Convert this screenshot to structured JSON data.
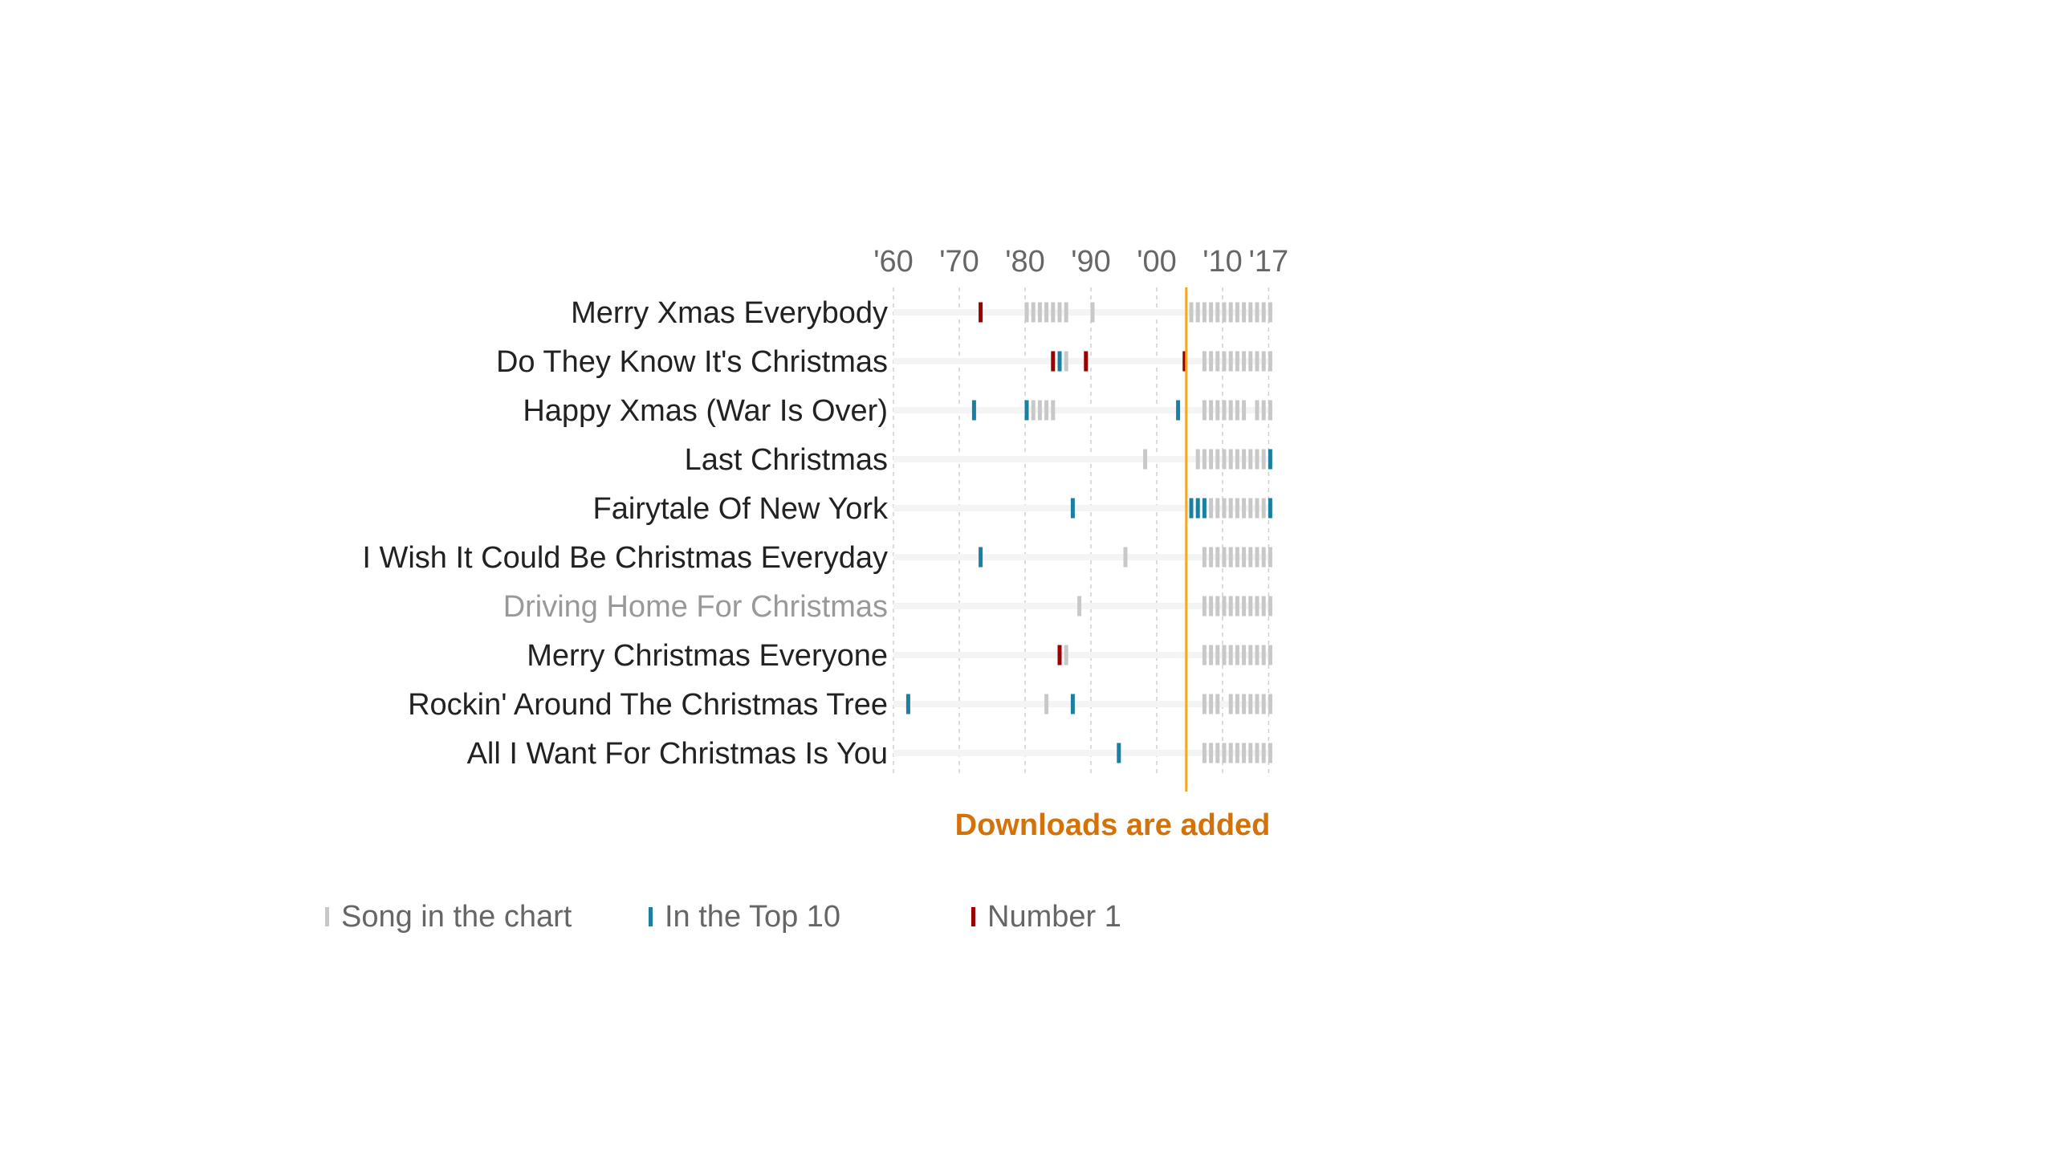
{
  "chart_data": {
    "type": "table",
    "subtype": "timeline-strip",
    "title": "",
    "xlabel": "",
    "ylabel": "",
    "x_range": [
      1960,
      2017
    ],
    "x_ticks": [
      {
        "year": 1960,
        "label": "'60"
      },
      {
        "year": 1970,
        "label": "'70"
      },
      {
        "year": 1980,
        "label": "'80"
      },
      {
        "year": 1990,
        "label": "'90"
      },
      {
        "year": 2000,
        "label": "'00"
      },
      {
        "year": 2010,
        "label": "'10"
      },
      {
        "year": 2017,
        "label": "'17"
      }
    ],
    "grid": true,
    "status_legend": {
      "chart": {
        "label": "Song in the chart",
        "color": "#c8c8c8"
      },
      "top10": {
        "label": "In the Top 10",
        "color": "#1a7fa0"
      },
      "number1": {
        "label": "Number 1",
        "color": "#990000"
      }
    },
    "annotation": {
      "label": "Downloads are added",
      "year": 2004,
      "line_color": "#f5a623",
      "text_color": "#d4720a"
    },
    "songs": [
      {
        "title": "Merry Xmas Everybody",
        "muted": false,
        "entries": [
          {
            "year": 1973,
            "status": "number1"
          },
          {
            "year": 1980,
            "status": "chart"
          },
          {
            "year": 1981,
            "status": "chart"
          },
          {
            "year": 1982,
            "status": "chart"
          },
          {
            "year": 1983,
            "status": "chart"
          },
          {
            "year": 1984,
            "status": "chart"
          },
          {
            "year": 1985,
            "status": "chart"
          },
          {
            "year": 1986,
            "status": "chart"
          },
          {
            "year": 1990,
            "status": "chart"
          },
          {
            "year": 2005,
            "status": "chart"
          },
          {
            "year": 2006,
            "status": "chart"
          },
          {
            "year": 2007,
            "status": "chart"
          },
          {
            "year": 2008,
            "status": "chart"
          },
          {
            "year": 2009,
            "status": "chart"
          },
          {
            "year": 2010,
            "status": "chart"
          },
          {
            "year": 2011,
            "status": "chart"
          },
          {
            "year": 2012,
            "status": "chart"
          },
          {
            "year": 2013,
            "status": "chart"
          },
          {
            "year": 2014,
            "status": "chart"
          },
          {
            "year": 2015,
            "status": "chart"
          },
          {
            "year": 2016,
            "status": "chart"
          },
          {
            "year": 2017,
            "status": "chart"
          }
        ]
      },
      {
        "title": "Do They Know It's Christmas",
        "muted": false,
        "entries": [
          {
            "year": 1984,
            "status": "number1"
          },
          {
            "year": 1985,
            "status": "top10"
          },
          {
            "year": 1986,
            "status": "chart"
          },
          {
            "year": 1989,
            "status": "number1"
          },
          {
            "year": 2004,
            "status": "number1"
          },
          {
            "year": 2007,
            "status": "chart"
          },
          {
            "year": 2008,
            "status": "chart"
          },
          {
            "year": 2009,
            "status": "chart"
          },
          {
            "year": 2010,
            "status": "chart"
          },
          {
            "year": 2011,
            "status": "chart"
          },
          {
            "year": 2012,
            "status": "chart"
          },
          {
            "year": 2013,
            "status": "chart"
          },
          {
            "year": 2014,
            "status": "chart"
          },
          {
            "year": 2015,
            "status": "chart"
          },
          {
            "year": 2016,
            "status": "chart"
          },
          {
            "year": 2017,
            "status": "chart"
          }
        ]
      },
      {
        "title": "Happy Xmas (War Is Over)",
        "muted": false,
        "entries": [
          {
            "year": 1972,
            "status": "top10"
          },
          {
            "year": 1980,
            "status": "top10"
          },
          {
            "year": 1981,
            "status": "chart"
          },
          {
            "year": 1982,
            "status": "chart"
          },
          {
            "year": 1983,
            "status": "chart"
          },
          {
            "year": 1984,
            "status": "chart"
          },
          {
            "year": 2003,
            "status": "top10"
          },
          {
            "year": 2007,
            "status": "chart"
          },
          {
            "year": 2008,
            "status": "chart"
          },
          {
            "year": 2009,
            "status": "chart"
          },
          {
            "year": 2010,
            "status": "chart"
          },
          {
            "year": 2011,
            "status": "chart"
          },
          {
            "year": 2012,
            "status": "chart"
          },
          {
            "year": 2013,
            "status": "chart"
          },
          {
            "year": 2015,
            "status": "chart"
          },
          {
            "year": 2016,
            "status": "chart"
          },
          {
            "year": 2017,
            "status": "chart"
          }
        ]
      },
      {
        "title": "Last Christmas",
        "muted": false,
        "entries": [
          {
            "year": 1998,
            "status": "chart"
          },
          {
            "year": 2006,
            "status": "chart"
          },
          {
            "year": 2007,
            "status": "chart"
          },
          {
            "year": 2008,
            "status": "chart"
          },
          {
            "year": 2009,
            "status": "chart"
          },
          {
            "year": 2010,
            "status": "chart"
          },
          {
            "year": 2011,
            "status": "chart"
          },
          {
            "year": 2012,
            "status": "chart"
          },
          {
            "year": 2013,
            "status": "chart"
          },
          {
            "year": 2014,
            "status": "chart"
          },
          {
            "year": 2015,
            "status": "chart"
          },
          {
            "year": 2016,
            "status": "chart"
          },
          {
            "year": 2017,
            "status": "top10"
          }
        ]
      },
      {
        "title": "Fairytale Of New York",
        "muted": false,
        "entries": [
          {
            "year": 1987,
            "status": "top10"
          },
          {
            "year": 2005,
            "status": "top10"
          },
          {
            "year": 2006,
            "status": "top10"
          },
          {
            "year": 2007,
            "status": "top10"
          },
          {
            "year": 2008,
            "status": "chart"
          },
          {
            "year": 2009,
            "status": "chart"
          },
          {
            "year": 2010,
            "status": "chart"
          },
          {
            "year": 2011,
            "status": "chart"
          },
          {
            "year": 2012,
            "status": "chart"
          },
          {
            "year": 2013,
            "status": "chart"
          },
          {
            "year": 2014,
            "status": "chart"
          },
          {
            "year": 2015,
            "status": "chart"
          },
          {
            "year": 2016,
            "status": "chart"
          },
          {
            "year": 2017,
            "status": "top10"
          }
        ]
      },
      {
        "title": "I Wish It Could Be Christmas Everyday",
        "muted": false,
        "entries": [
          {
            "year": 1973,
            "status": "top10"
          },
          {
            "year": 1995,
            "status": "chart"
          },
          {
            "year": 2007,
            "status": "chart"
          },
          {
            "year": 2008,
            "status": "chart"
          },
          {
            "year": 2009,
            "status": "chart"
          },
          {
            "year": 2010,
            "status": "chart"
          },
          {
            "year": 2011,
            "status": "chart"
          },
          {
            "year": 2012,
            "status": "chart"
          },
          {
            "year": 2013,
            "status": "chart"
          },
          {
            "year": 2014,
            "status": "chart"
          },
          {
            "year": 2015,
            "status": "chart"
          },
          {
            "year": 2016,
            "status": "chart"
          },
          {
            "year": 2017,
            "status": "chart"
          }
        ]
      },
      {
        "title": "Driving Home For Christmas",
        "muted": true,
        "entries": [
          {
            "year": 1988,
            "status": "chart"
          },
          {
            "year": 2007,
            "status": "chart"
          },
          {
            "year": 2008,
            "status": "chart"
          },
          {
            "year": 2009,
            "status": "chart"
          },
          {
            "year": 2010,
            "status": "chart"
          },
          {
            "year": 2011,
            "status": "chart"
          },
          {
            "year": 2012,
            "status": "chart"
          },
          {
            "year": 2013,
            "status": "chart"
          },
          {
            "year": 2014,
            "status": "chart"
          },
          {
            "year": 2015,
            "status": "chart"
          },
          {
            "year": 2016,
            "status": "chart"
          },
          {
            "year": 2017,
            "status": "chart"
          }
        ]
      },
      {
        "title": "Merry Christmas Everyone",
        "muted": false,
        "entries": [
          {
            "year": 1985,
            "status": "number1"
          },
          {
            "year": 1986,
            "status": "chart"
          },
          {
            "year": 2007,
            "status": "chart"
          },
          {
            "year": 2008,
            "status": "chart"
          },
          {
            "year": 2009,
            "status": "chart"
          },
          {
            "year": 2010,
            "status": "chart"
          },
          {
            "year": 2011,
            "status": "chart"
          },
          {
            "year": 2012,
            "status": "chart"
          },
          {
            "year": 2013,
            "status": "chart"
          },
          {
            "year": 2014,
            "status": "chart"
          },
          {
            "year": 2015,
            "status": "chart"
          },
          {
            "year": 2016,
            "status": "chart"
          },
          {
            "year": 2017,
            "status": "chart"
          }
        ]
      },
      {
        "title": "Rockin' Around The Christmas Tree",
        "muted": false,
        "entries": [
          {
            "year": 1962,
            "status": "top10"
          },
          {
            "year": 1983,
            "status": "chart"
          },
          {
            "year": 1987,
            "status": "top10"
          },
          {
            "year": 2007,
            "status": "chart"
          },
          {
            "year": 2008,
            "status": "chart"
          },
          {
            "year": 2009,
            "status": "chart"
          },
          {
            "year": 2011,
            "status": "chart"
          },
          {
            "year": 2012,
            "status": "chart"
          },
          {
            "year": 2013,
            "status": "chart"
          },
          {
            "year": 2014,
            "status": "chart"
          },
          {
            "year": 2015,
            "status": "chart"
          },
          {
            "year": 2016,
            "status": "chart"
          },
          {
            "year": 2017,
            "status": "chart"
          }
        ]
      },
      {
        "title": "All I Want For Christmas Is You",
        "muted": false,
        "entries": [
          {
            "year": 1994,
            "status": "top10"
          },
          {
            "year": 2007,
            "status": "chart"
          },
          {
            "year": 2008,
            "status": "chart"
          },
          {
            "year": 2009,
            "status": "chart"
          },
          {
            "year": 2010,
            "status": "chart"
          },
          {
            "year": 2011,
            "status": "chart"
          },
          {
            "year": 2012,
            "status": "chart"
          },
          {
            "year": 2013,
            "status": "chart"
          },
          {
            "year": 2014,
            "status": "chart"
          },
          {
            "year": 2015,
            "status": "chart"
          },
          {
            "year": 2016,
            "status": "chart"
          },
          {
            "year": 2017,
            "status": "chart"
          }
        ]
      }
    ]
  },
  "legend": {
    "items": [
      {
        "key": "chart",
        "label": "Song in the chart"
      },
      {
        "key": "top10",
        "label": "In the Top 10"
      },
      {
        "key": "number1",
        "label": "Number 1"
      }
    ]
  }
}
